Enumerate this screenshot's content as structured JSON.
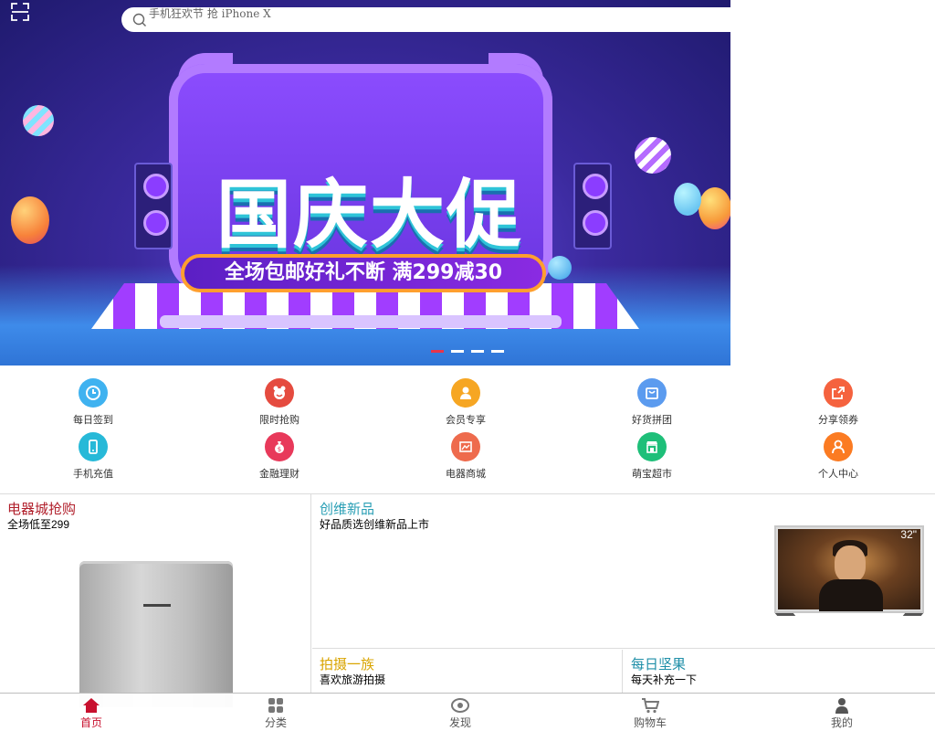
{
  "search": {
    "placeholder": "手机狂欢节 抢 iPhone X"
  },
  "banner": {
    "headline": "国庆大促",
    "subline": "全场包邮好礼不断 满299减30",
    "slides": 4,
    "active_slide": 1
  },
  "quick_links": [
    {
      "label": "每日签到",
      "icon": "clock-icon",
      "color": "#3fb2f0"
    },
    {
      "label": "限时抢购",
      "icon": "flash-deal-icon",
      "color": "#e54b3f"
    },
    {
      "label": "会员专享",
      "icon": "member-icon",
      "color": "#f6a623"
    },
    {
      "label": "好货拼团",
      "icon": "shopping-bag-icon",
      "color": "#5b9bef"
    },
    {
      "label": "分享领券",
      "icon": "share-icon",
      "color": "#f5623e"
    },
    {
      "label": "手机充值",
      "icon": "phone-icon",
      "color": "#27b9d8"
    },
    {
      "label": "金融理财",
      "icon": "money-bag-icon",
      "color": "#e8395a"
    },
    {
      "label": "电器商城",
      "icon": "appliance-icon",
      "color": "#ee6b4d"
    },
    {
      "label": "萌宝超市",
      "icon": "store-icon",
      "color": "#1ebf79"
    },
    {
      "label": "个人中心",
      "icon": "user-icon",
      "color": "#fb7b22"
    }
  ],
  "panels": {
    "appliance": {
      "title": "电器城抢购",
      "subtitle": "全场低至299",
      "color": "#b11f2b"
    },
    "new_products": {
      "title": "创维新品",
      "subtitle": "好品质选创维新品上市",
      "color": "#2a9fb5",
      "tv_size": "32\""
    },
    "travel": {
      "title": "拍摄一族",
      "subtitle": "喜欢旅游拍摄",
      "color": "#d9a400"
    },
    "nuts": {
      "title": "每日坚果",
      "subtitle": "每天补充一下",
      "color": "#1f8fa8"
    }
  },
  "tabbar": {
    "items": [
      {
        "label": "首页",
        "icon": "home-icon",
        "active": true
      },
      {
        "label": "分类",
        "icon": "category-icon",
        "active": false
      },
      {
        "label": "发现",
        "icon": "eye-icon",
        "active": false
      },
      {
        "label": "购物车",
        "icon": "cart-icon",
        "active": false
      },
      {
        "label": "我的",
        "icon": "profile-icon",
        "active": false
      }
    ],
    "active_color": "#c8102e"
  }
}
